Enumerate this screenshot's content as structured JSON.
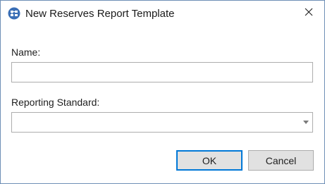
{
  "window": {
    "title": "New Reserves Report Template",
    "app_icon": "reserves-report-icon",
    "close_icon": "close-icon"
  },
  "form": {
    "name_label": "Name:",
    "name_value": "",
    "reporting_standard_label": "Reporting Standard:",
    "reporting_standard_value": ""
  },
  "buttons": {
    "ok_label": "OK",
    "cancel_label": "Cancel"
  },
  "colors": {
    "window_border": "#6f8fb6",
    "default_button_border": "#0078d7",
    "button_face": "#e1e1e1",
    "icon_blue": "#3b6fb6"
  }
}
